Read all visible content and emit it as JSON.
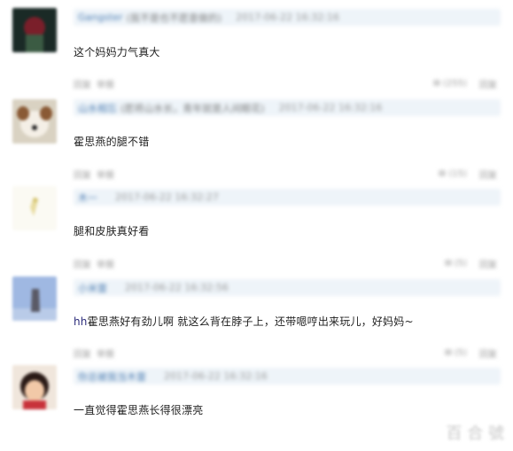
{
  "comments": [
    {
      "user": "Gangster",
      "note": "(我不是也不愿意做的)",
      "time": "2017-06-22 16:32:16",
      "text": "这个妈妈力气真大",
      "reply_label": "回复",
      "report_label": "举报",
      "like_label": "(255)",
      "more_label": "回复"
    },
    {
      "user": "山水相忘",
      "note": "(愿将山水长，青年就是人间眼花)",
      "time": "2017-06-22 16:32:16",
      "text": "霍思燕的腿不错",
      "reply_label": "回复",
      "report_label": "举报",
      "like_label": "(15)",
      "more_label": "回复"
    },
    {
      "user": "木一",
      "note": "",
      "time": "2017-06-22 16:32:27",
      "text": "腿和皮肤真好看",
      "reply_label": "回复",
      "report_label": "举报",
      "like_label": "(5)",
      "more_label": "回复"
    },
    {
      "user": "小米雷",
      "note": "",
      "time": "2017-06-22 16:32:56",
      "text_prefix": "hh",
      "text": "霍思燕好有劲儿啊 就这么背在脖子上，还带嗯哼出来玩儿，好妈妈~",
      "reply_label": "回复",
      "report_label": "举报",
      "like_label": "(5)",
      "more_label": "回复"
    },
    {
      "user": "你总被我当木雷",
      "note": "",
      "time": "2017-06-22 16:32:16",
      "text": "一直觉得霍思燕长得很漂亮",
      "reply_label": "",
      "report_label": "",
      "like_label": "",
      "more_label": ""
    }
  ],
  "watermark": "百 合 號",
  "colors": {
    "meta_bg": "#eef4f9",
    "username": "#4f7fb3",
    "text": "#1f1f1f"
  }
}
